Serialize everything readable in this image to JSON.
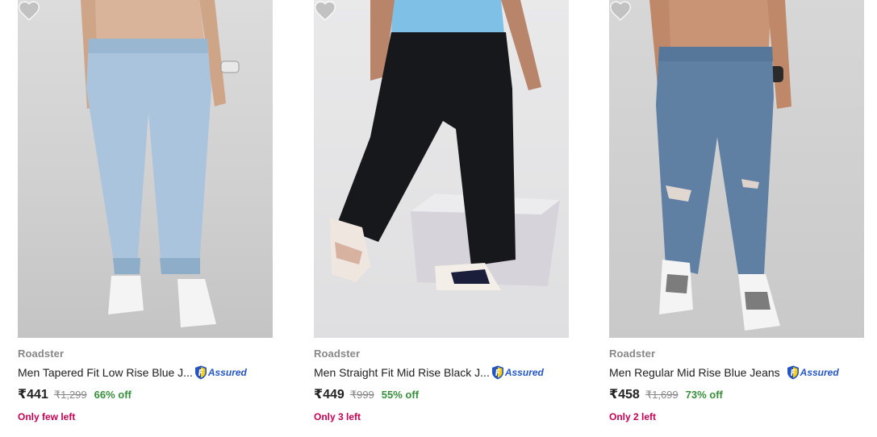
{
  "colors": {
    "brand": "#878787",
    "title": "#212121",
    "discount": "#388e3c",
    "stock": "#c70055",
    "assured": "#2455c3",
    "wishlist": "#c2c2c2"
  },
  "products": [
    {
      "brand": "Roadster",
      "title": "Men Tapered Fit Low Rise Blue J...",
      "assured_label": "Assured",
      "price": "₹441",
      "mrp": "₹1,299",
      "discount": "66% off",
      "stock": "Only few left",
      "icons": {
        "wishlist": "heart-icon",
        "assured": "flipkart-assured-icon"
      }
    },
    {
      "brand": "Roadster",
      "title": "Men Straight Fit Mid Rise Black J...",
      "assured_label": "Assured",
      "price": "₹449",
      "mrp": "₹999",
      "discount": "55% off",
      "stock": "Only 3 left",
      "icons": {
        "wishlist": "heart-icon",
        "assured": "flipkart-assured-icon"
      }
    },
    {
      "brand": "Roadster",
      "title": "Men Regular Mid Rise Blue Jeans",
      "assured_label": "Assured",
      "price": "₹458",
      "mrp": "₹1,699",
      "discount": "73% off",
      "stock": "Only 2 left",
      "icons": {
        "wishlist": "heart-icon",
        "assured": "flipkart-assured-icon"
      }
    }
  ]
}
